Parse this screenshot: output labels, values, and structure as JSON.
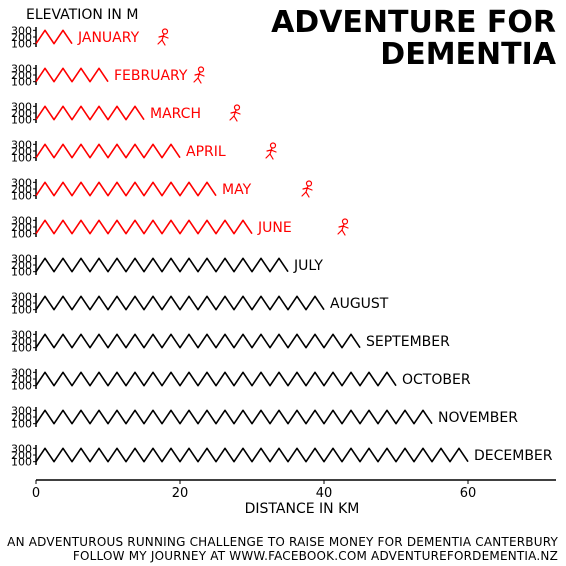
{
  "title_line1": "ADVENTURE FOR",
  "title_line2": "DEMENTIA",
  "footer_line1": "AN ADVENTUROUS RUNNING CHALLENGE TO RAISE MONEY FOR DEMENTIA CANTERBURY",
  "footer_line2": "FOLLOW MY JOURNEY AT WWW.FACEBOOK.COM ADVENTUREFORDEMENTIA.NZ",
  "chart_data": {
    "type": "line",
    "title": "ADVENTURE FOR DEMENTIA",
    "ylabel": "ELEVATION IN M",
    "xlabel": "DISTANCE IN KM",
    "xlim": [
      0,
      72
    ],
    "x_ticks": [
      0,
      20,
      40,
      60
    ],
    "y_ticks": [
      100,
      200,
      300
    ],
    "ylim": [
      50,
      350
    ],
    "completed_color": "#ff0000",
    "pending_color": "#000000",
    "runner_icon": "running-figure-icon",
    "series": [
      {
        "name": "JANUARY",
        "distance_km": 5,
        "completed": true
      },
      {
        "name": "FEBRUARY",
        "distance_km": 10,
        "completed": true
      },
      {
        "name": "MARCH",
        "distance_km": 15,
        "completed": true
      },
      {
        "name": "APRIL",
        "distance_km": 20,
        "completed": true
      },
      {
        "name": "MAY",
        "distance_km": 25,
        "completed": true
      },
      {
        "name": "JUNE",
        "distance_km": 30,
        "completed": true
      },
      {
        "name": "JULY",
        "distance_km": 35,
        "completed": false
      },
      {
        "name": "AUGUST",
        "distance_km": 40,
        "completed": false
      },
      {
        "name": "SEPTEMBER",
        "distance_km": 45,
        "completed": false
      },
      {
        "name": "OCTOBER",
        "distance_km": 50,
        "completed": false
      },
      {
        "name": "NOVEMBER",
        "distance_km": 55,
        "completed": false
      },
      {
        "name": "DECEMBER",
        "distance_km": 60,
        "completed": false
      }
    ],
    "elevation_profile": {
      "low_m": 100,
      "high_m": 300,
      "peak_every_km": 2.5
    }
  }
}
